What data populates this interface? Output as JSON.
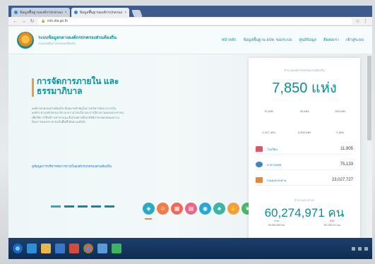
{
  "browser": {
    "tabs": [
      {
        "label": "ข้อมูลพื้นฐานองค์กรปกครอง",
        "active": false
      },
      {
        "label": "ข้อมูลพื้นฐานองค์กรปกครอง",
        "active": true
      }
    ],
    "url": "info.dla.go.th",
    "colors": {
      "tabstrip": "#3d5b8c",
      "taskbar": "#133a66"
    }
  },
  "header": {
    "brand_name": "ระบบข้อมูลกลางองค์กรปกครองส่วนท้องถิ่น",
    "brand_sub": "กรมส่งเสริมการปกครองท้องถิ่น",
    "menu": [
      "หน้าหลัก",
      "ข้อมูลพื้นฐาน อปท. ของระบบ",
      "ศูนย์ข้อมูล",
      "ติดต่อเรา",
      "เข้าสู่ระบบ"
    ],
    "colors": {
      "primary": "#0a8f96",
      "accent": "#f09a3e"
    }
  },
  "hero": {
    "title": "การจัดการภายใน และธรรมาภิบาล",
    "body": "องค์กรปกครองส่วนท้องถิ่น มีบทบาทสำคัญในการบริหารจัดการภายในองค์กร ตามหลักธรรมาภิบาล ความโปร่งใส และการมีส่วนร่วมของประชาชน เพื่อให้การให้บริการสาธารณะเป็นไปอย่างมีประสิทธิภาพ ตอบสนองความต้องการของประชาชนในพื้นที่ได้อย่างแท้จริง",
    "link": "ดูข้อมูลการบริหารจัดการภายในองค์กรปกครองส่วนท้องถิ่น",
    "slides": 5
  },
  "icons": [
    {
      "name": "shield-icon",
      "color": "#2aa9c2"
    },
    {
      "name": "people-icon",
      "color": "#ef7d4a"
    },
    {
      "name": "building-icon",
      "color": "#ef6a5a"
    },
    {
      "name": "document-icon",
      "color": "#e8668c"
    },
    {
      "name": "water-icon",
      "color": "#2da4d8"
    },
    {
      "name": "tree-icon",
      "color": "#3cb4a8"
    },
    {
      "name": "hand-icon",
      "color": "#f2a03f"
    },
    {
      "name": "leaf-icon",
      "color": "#45b96a"
    }
  ],
  "stats": {
    "orgs_label": "จำนวนองค์กรปกครองส่วนท้องถิ่น",
    "orgs_total": "7,850 แห่ง",
    "grid_top": [
      "76 แห่ง",
      "30 แห่ง",
      "195 แห่ง"
    ],
    "grid_bottom": [
      "1,247 แห่ง",
      "5,300 แห่ง",
      "2 แห่ง"
    ],
    "rows": [
      {
        "label": "โรงเรียน",
        "value": "11,905",
        "icon": "school-icon",
        "color": "#e3526a"
      },
      {
        "label": "สาธารณสุข",
        "value": "75,133",
        "icon": "heart-icon",
        "color": "#3d86c6"
      },
      {
        "label": "ถนนและสะพาน",
        "value": "23,027,727",
        "icon": "road-icon",
        "color": "#e6883a"
      }
    ],
    "pop_label": "จำนวนประชากร",
    "population": "60,274,971 คน",
    "male_label": "ชาย",
    "male": "29,526,499 คน",
    "female_label": "หญิง",
    "female": "30,748,472 คน"
  }
}
